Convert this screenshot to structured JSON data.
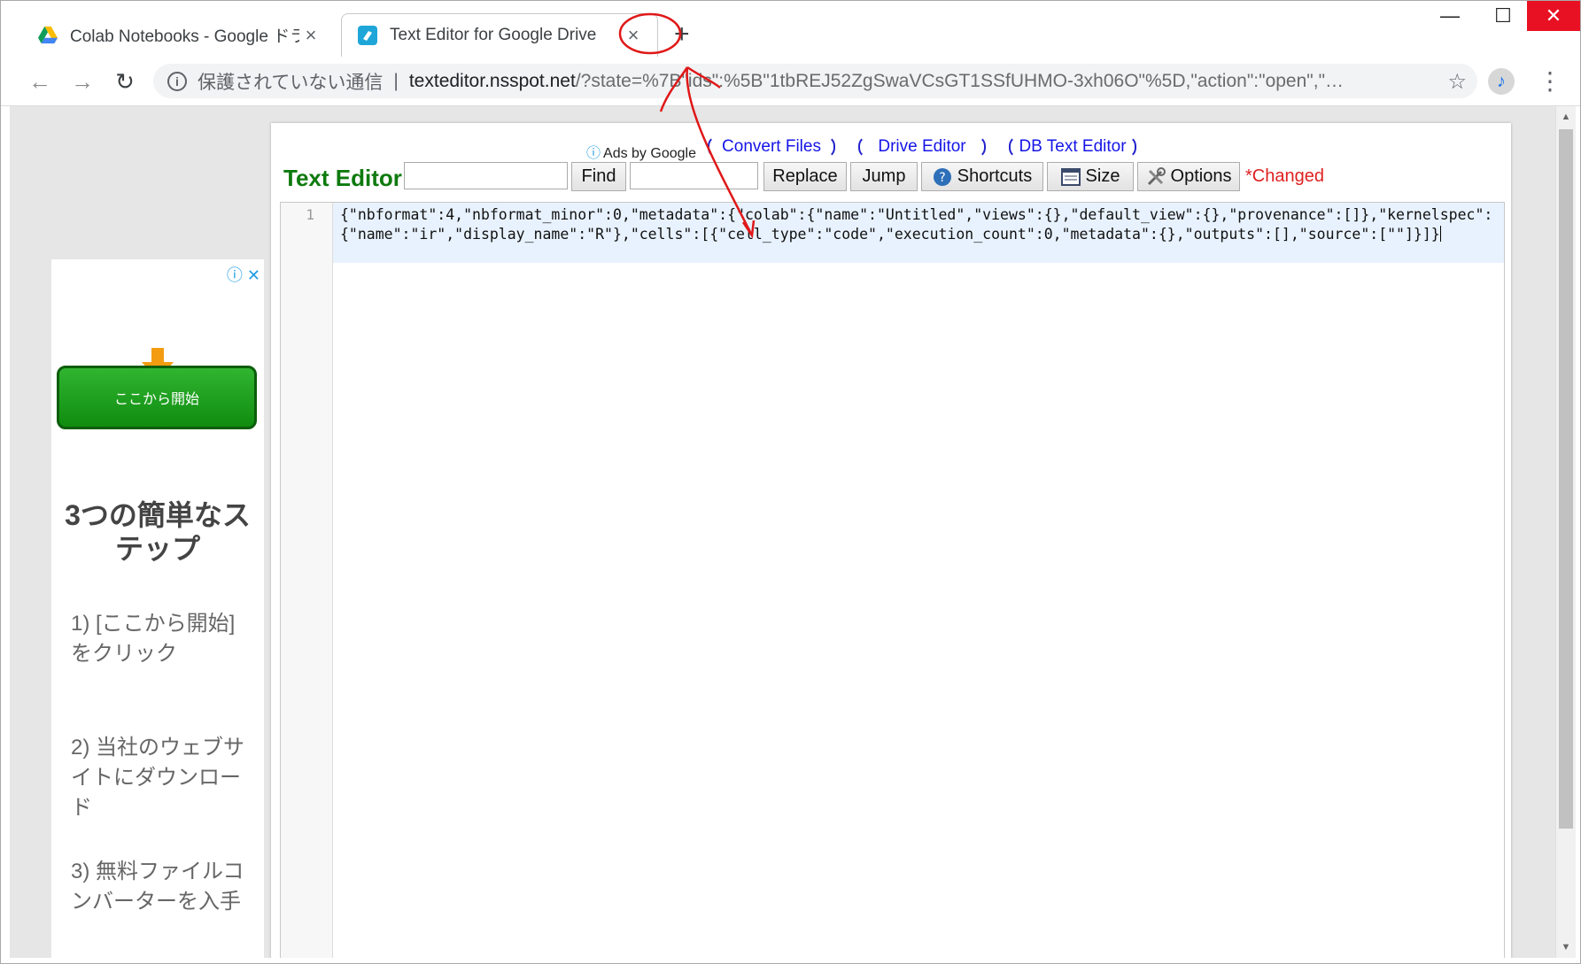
{
  "browser": {
    "tabs": [
      {
        "title": "Colab Notebooks - Google ドライ",
        "close": "×"
      },
      {
        "title": "Text Editor for Google Drive",
        "close": "×"
      }
    ],
    "new_tab": "+",
    "window_controls": {
      "minimize": "—",
      "maximize": "☐",
      "close": "✕"
    },
    "nav": {
      "back": "←",
      "forward": "→",
      "reload": "↻"
    },
    "omnibox": {
      "info": "i",
      "insecure_label": "保護されていない通信",
      "separator": "|",
      "host": "texteditor.nsspot.net",
      "path": "/?state=%7B\"ids\":%5B\"1tbREJ52ZgSwaVCsGT1SSfUHMO-3xh06O\"%5D,\"action\":\"open\",\"…",
      "star": "☆"
    },
    "extension": "♪",
    "menu": "⋮"
  },
  "ad": {
    "icons": "ⓘ ✕",
    "button_label": "ここから開始",
    "heading": "3つの簡単なステップ",
    "steps": [
      "1) [ここから開始]をクリック",
      "2) 当社のウェブサイトにダウンロード",
      "3) 無料ファイルコンバーターを入手"
    ]
  },
  "editor_page": {
    "ads_by": "Ads by Google",
    "links": [
      "Convert Files",
      "Drive Editor",
      "DB Text Editor"
    ],
    "app_title": "Text Editor",
    "find_label": "Find",
    "replace_label": "Replace",
    "jump_label": "Jump",
    "shortcuts_label": "Shortcuts",
    "size_label": "Size",
    "options_label": "Options",
    "changed_label": "*Changed",
    "line_number": "1",
    "content": "{\"nbformat\":4,\"nbformat_minor\":0,\"metadata\":{\"colab\":{\"name\":\"Untitled\",\"views\":{},\"default_view\":{},\"provenance\":[]},\"kernelspec\":{\"name\":\"ir\",\"display_name\":\"R\"},\"cells\":[{\"cell_type\":\"code\",\"execution_count\":0,\"metadata\":{},\"outputs\":[],\"source\":[\"\"]}]}"
  },
  "colors": {
    "app_title": "#0e7a0e",
    "changed": "#e02020",
    "link": "#1515e8",
    "annotation": "#e01818",
    "ad_button": "#19a019",
    "tab_close_button": "#e81123"
  }
}
